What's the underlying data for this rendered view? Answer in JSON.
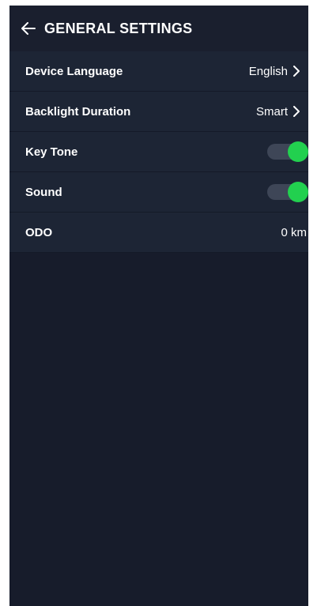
{
  "header": {
    "back_icon": "arrow-left-icon",
    "title": "GENERAL SETTINGS"
  },
  "settings": {
    "items": [
      {
        "label": "Device Language",
        "value": "English",
        "type": "select"
      },
      {
        "label": "Backlight Duration",
        "value": "Smart",
        "type": "select"
      },
      {
        "label": "Key Tone",
        "state": "on",
        "type": "toggle"
      },
      {
        "label": "Sound",
        "state": "on",
        "type": "toggle"
      },
      {
        "label": "ODO",
        "value": "0 km",
        "type": "readonly"
      }
    ]
  },
  "colors": {
    "background": "#171c2b",
    "row_background": "#1d2535",
    "toggle_on": "#22d04f",
    "toggle_track": "#3e4657"
  }
}
